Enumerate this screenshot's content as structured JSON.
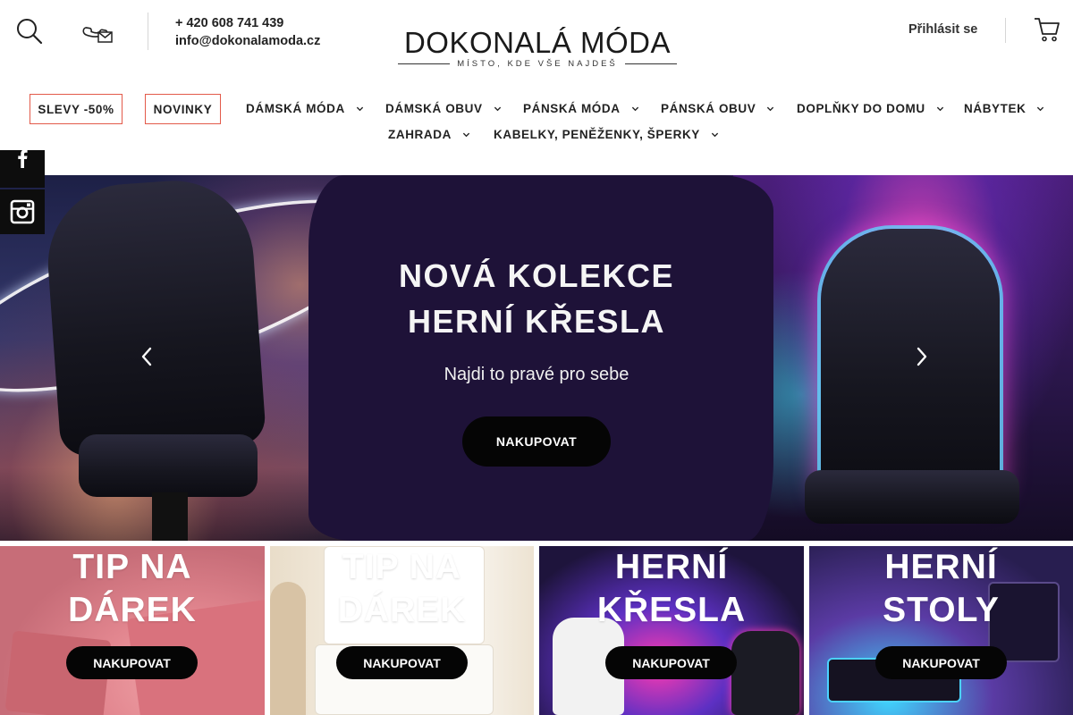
{
  "header": {
    "phone": "+ 420 608 741 439",
    "email": "info@dokonalamoda.cz",
    "logo_main": "DOKONALÁ MÓDA",
    "logo_tagline": "MÍSTO, KDE VŠE NAJDEŠ",
    "login_label": "Přihlásit se",
    "icons": {
      "search": "search-icon",
      "contact": "phone-mail-icon",
      "cart": "cart-icon"
    }
  },
  "nav": {
    "highlight_items": [
      {
        "label": "SLEVY -50%"
      },
      {
        "label": "NOVINKY"
      }
    ],
    "items": [
      {
        "label": "DÁMSKÁ MÓDA"
      },
      {
        "label": "DÁMSKÁ OBUV"
      },
      {
        "label": "PÁNSKÁ MÓDA"
      },
      {
        "label": "PÁNSKÁ OBUV"
      },
      {
        "label": "DOPLŇKY DO DOMU"
      },
      {
        "label": "NÁBYTEK"
      },
      {
        "label": "ZAHRADA"
      },
      {
        "label": "KABELKY, PENĚŽENKY, ŠPERKY"
      }
    ],
    "highlight_border_color": "#e35a4a"
  },
  "social": {
    "icons": [
      "facebook-icon",
      "instagram-icon"
    ]
  },
  "hero": {
    "title_line1": "NOVÁ KOLEKCE",
    "title_line2": "HERNÍ KŘESLA",
    "subtitle": "Najdi to pravé pro sebe",
    "button_label": "NAKUPOVAT",
    "icons": {
      "prev": "chevron-left-icon",
      "next": "chevron-right-icon"
    }
  },
  "tiles": [
    {
      "title_line1": "TIP NA",
      "title_line2": "DÁREK",
      "button_label": "NAKUPOVAT"
    },
    {
      "title_line1": "TIP NA",
      "title_line2": "DÁREK",
      "button_label": "NAKUPOVAT"
    },
    {
      "title_line1": "HERNÍ",
      "title_line2": "KŘESLA",
      "button_label": "NAKUPOVAT"
    },
    {
      "title_line1": "HERNÍ",
      "title_line2": "STOLY",
      "button_label": "NAKUPOVAT"
    }
  ]
}
